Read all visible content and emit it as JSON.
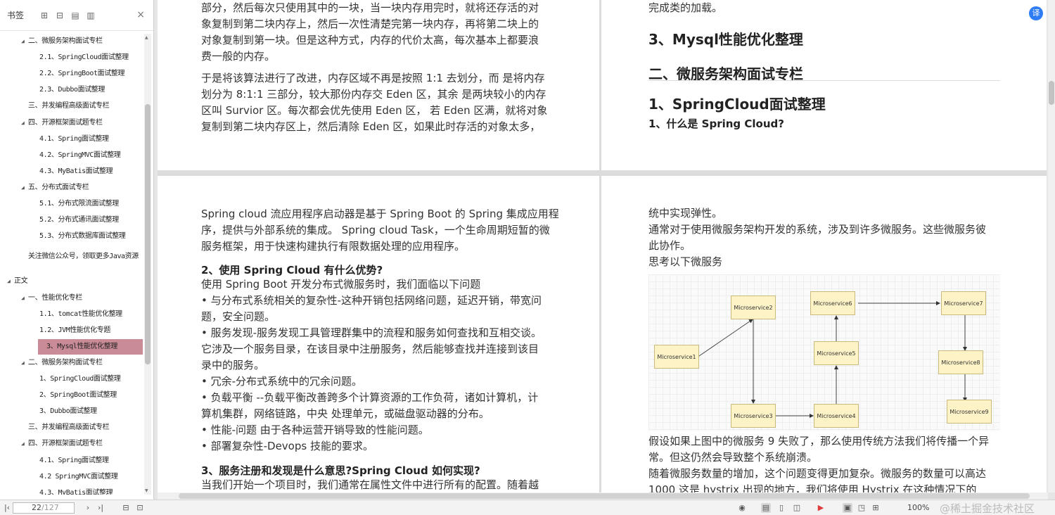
{
  "sidebar": {
    "title": "书签",
    "tools": [
      "☐",
      "☐",
      "☐",
      "☐"
    ],
    "close": "×",
    "items": [
      {
        "text": "二、微服务架构面试专栏",
        "lvl": 1,
        "tw": "◢"
      },
      {
        "text": "2.1、SpringCloud面试整理",
        "lvl": 2,
        "tw": ""
      },
      {
        "text": "2.2、SpringBoot面试整理",
        "lvl": 2,
        "tw": ""
      },
      {
        "text": "2.3、Dubbo面试整理",
        "lvl": 2,
        "tw": ""
      },
      {
        "text": "三、并发编程高级面试专栏",
        "lvl": 1,
        "tw": ""
      },
      {
        "text": "四、开源框架面试题专栏",
        "lvl": 1,
        "tw": "◢"
      },
      {
        "text": "4.1、Spring面试整理",
        "lvl": 2,
        "tw": ""
      },
      {
        "text": "4.2、SpringMVC面试整理",
        "lvl": 2,
        "tw": ""
      },
      {
        "text": "4.3、MyBatis面试整理",
        "lvl": 2,
        "tw": ""
      },
      {
        "text": "五、分布式面试专栏",
        "lvl": 1,
        "tw": "◢"
      },
      {
        "text": "5.1、分布式限流面试整理",
        "lvl": 2,
        "tw": ""
      },
      {
        "text": "5.2、分布式通讯面试整理",
        "lvl": 2,
        "tw": ""
      },
      {
        "text": "5.3、分布式数据库面试整理",
        "lvl": 2,
        "tw": ""
      },
      {
        "text": "关注微信公众号，领取更多Java资源",
        "lvl": 1,
        "tw": ""
      },
      {
        "text": "正文",
        "lvl": 0,
        "tw": "◢"
      },
      {
        "text": "一、性能优化专栏",
        "lvl": 1,
        "tw": "◢"
      },
      {
        "text": "1.1、tomcat性能优化整理",
        "lvl": 2,
        "tw": ""
      },
      {
        "text": "1.2、JVM性能优化专题",
        "lvl": 2,
        "tw": ""
      },
      {
        "text": "3、Mysql性能优化整理",
        "lvl": 2,
        "tw": "",
        "sel": true
      },
      {
        "text": "二、微服务架构面试专栏",
        "lvl": 1,
        "tw": "◢"
      },
      {
        "text": "1、SpringCloud面试整理",
        "lvl": 2,
        "tw": ""
      },
      {
        "text": "2、SpringBoot面试整理",
        "lvl": 2,
        "tw": ""
      },
      {
        "text": "3、Dubbo面试整理",
        "lvl": 2,
        "tw": ""
      },
      {
        "text": "三、并发编程高级面试专栏",
        "lvl": 1,
        "tw": ""
      },
      {
        "text": "四、开源框架面试题专栏",
        "lvl": 1,
        "tw": "◢"
      },
      {
        "text": "4.1、Spring面试整理",
        "lvl": 2,
        "tw": ""
      },
      {
        "text": "4.2 SpringMVC面试整理",
        "lvl": 2,
        "tw": ""
      },
      {
        "text": "4.3、MyBatis面试整理",
        "lvl": 2,
        "tw": ""
      }
    ]
  },
  "page_tl": {
    "lines": [
      "部分，然后每次只使用其中的一块，当一块内存用完时，就将还存活的对",
      "象复制到第二块内存上，然后一次性清楚完第一块内存，再将第二块上的",
      "对象复制到第一块。但是这种方式，内存的代价太高，每次基本上都要浪",
      "费一般的内存。"
    ],
    "lines2": [
      "于是将该算法进行了改进，内存区域不再是按照 1:1 去划分，而 是将内存",
      "划分为 8:1:1 三部分，较大那份内存交 Eden 区，其余 是两块较小的内存",
      "区叫 Survior 区。每次都会优先使用 Eden 区， 若 Eden 区满，就将对象",
      "复制到第二块内存区上，然后清除 Eden 区，如果此时存活的对象太多，"
    ]
  },
  "page_tr": {
    "top_line": "完成类的加载。",
    "h_mysql": "3、Mysql性能优化整理",
    "h_micro": "二、微服务架构面试专栏",
    "h_sc": "1、SpringCloud面试整理",
    "q1": "1、什么是 Spring Cloud?"
  },
  "page_bl": {
    "intro": [
      "Spring cloud 流应用程序启动器是基于 Spring Boot 的 Spring 集成应用程",
      "序，提供与外部系统的集成。 Spring cloud Task，一个生命周期短暂的微",
      "服务框架，用于快速构建执行有限数据处理的应用程序。"
    ],
    "q2": "2、使用 Spring Cloud 有什么优势?",
    "body": [
      "使用 Spring Boot 开发分布式微服务时，我们面临以下问题",
      "• 与分布式系统相关的复杂性-这种开销包括网络问题，延迟开销，带宽问",
      "题，安全问题。",
      "• 服务发现-服务发现工具管理群集中的流程和服务如何查找和互相交谈。",
      "它涉及一个服务目录，在该目录中注册服务，然后能够查找并连接到该目",
      "录中的服务。",
      "• 冗余-分布式系统中的冗余问题。",
      "• 负载平衡 --负载平衡改善跨多个计算资源的工作负荷，诸如计算机，计",
      "算机集群，网络链路，中央 处理单元，或磁盘驱动器的分布。",
      "• 性能-问题 由于各种运营开销导致的性能问题。",
      "• 部署复杂性-Devops 技能的要求。"
    ],
    "q3": "3、服务注册和发现是什么意思?Spring Cloud 如何实现?",
    "tail": "当我们开始一个项目时，我们通常在属性文件中进行所有的配置。随着越"
  },
  "page_br": {
    "lines": [
      "统中实现弹性。",
      "通常对于使用微服务架构开发的系统，涉及到许多微服务。这些微服务彼",
      "此协作。",
      "思考以下微服务"
    ],
    "after": [
      "假设如果上图中的微服务 9 失败了，那么使用传统方法我们将传播一个异",
      "常。但这仍然会导致整个系统崩溃。",
      "随着微服务数量的增加，这个问题变得更加复杂。微服务的数量可以高达",
      "1000 这是 hystrix 出现的地方，我们将使用 Hystrix 在这种情况下的"
    ],
    "diagram": {
      "nodes": [
        "Microservice1",
        "Microservice2",
        "Microservice3",
        "Microservice4",
        "Microservice5",
        "Microservice6",
        "Microservice7",
        "Microservice8",
        "Microservice9"
      ]
    }
  },
  "status": {
    "page_current": "22",
    "page_total": "/127",
    "zoom": "100%",
    "watermark": "@稀土掘金技术社区"
  },
  "fab_icon": "translate-icon"
}
